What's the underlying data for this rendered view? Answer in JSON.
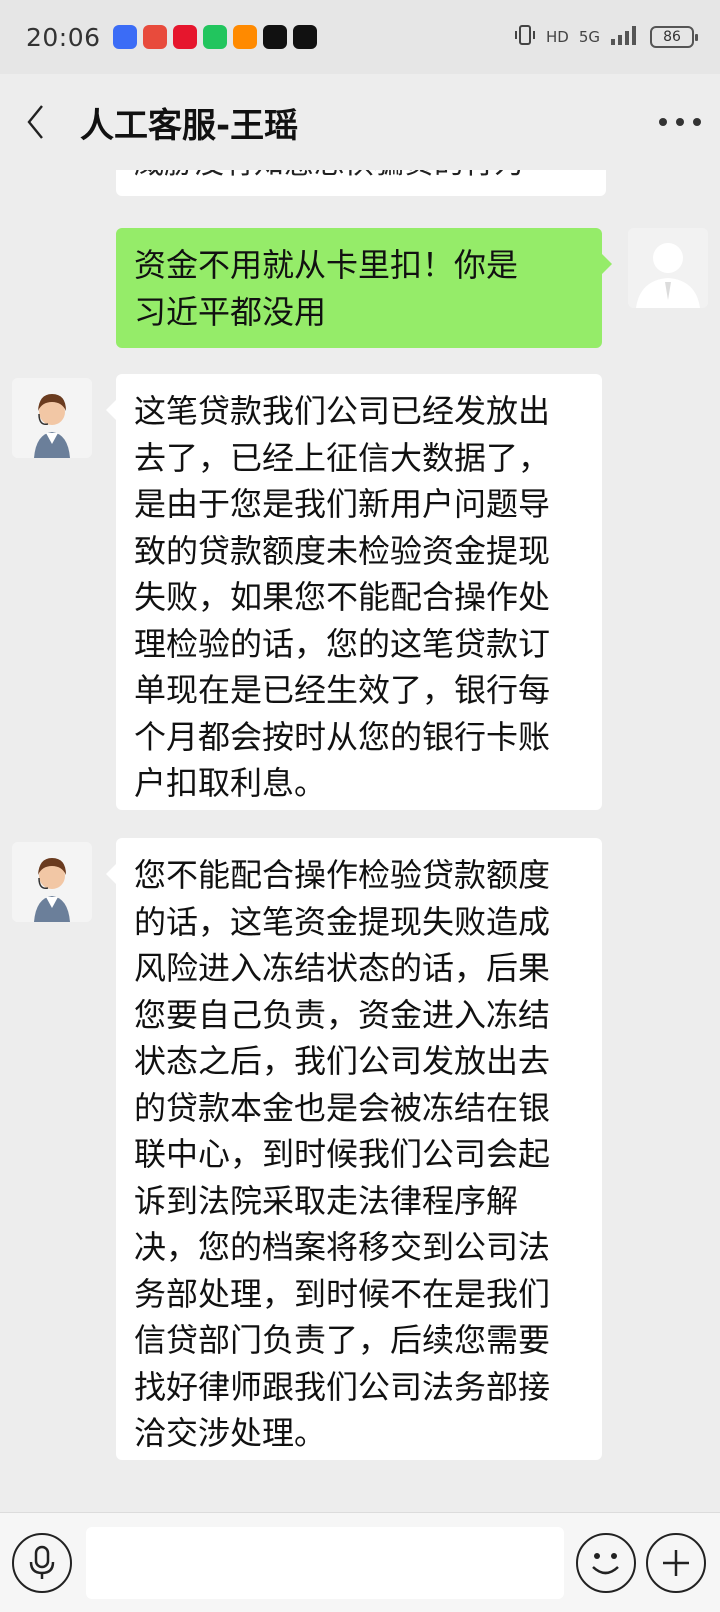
{
  "status_bar": {
    "time": "20:06",
    "network": "5G",
    "hd_label": "HD",
    "battery": "86",
    "notification_icons": [
      {
        "name": "baidu-icon",
        "color": "#3b6cf6"
      },
      {
        "name": "pinduoduo-icon",
        "color": "#e84b3c"
      },
      {
        "name": "weibo-icon",
        "color": "#e6162d"
      },
      {
        "name": "messages-icon",
        "color": "#22c55e"
      },
      {
        "name": "app-store-icon",
        "color": "#ff8a00"
      },
      {
        "name": "qq-icon",
        "color": "#111111"
      },
      {
        "name": "tiktok-icon",
        "color": "#111111"
      }
    ]
  },
  "header": {
    "title": "人工客服-王瑶"
  },
  "chat": {
    "partial_text": "威胁没有知感恐惧骗贷的行为",
    "messages": [
      {
        "sender": "me",
        "lines": [
          "资金不用就从卡里扣！你是",
          "习近平都没用"
        ]
      },
      {
        "sender": "agent",
        "lines": [
          "这笔贷款我们公司已经发放出",
          "去了，已经上征信大数据了，",
          "是由于您是我们新用户问题导",
          "致的贷款额度未检验资金提现",
          "失败，如果您不能配合操作处",
          "理检验的话，您的这笔贷款订",
          "单现在是已经生效了，银行每",
          "个月都会按时从您的银行卡账",
          "户扣取利息。"
        ]
      },
      {
        "sender": "agent",
        "lines": [
          "您不能配合操作检验贷款额度",
          "的话，这笔资金提现失败造成",
          "风险进入冻结状态的话，后果",
          "您要自己负责，资金进入冻结",
          "状态之后，我们公司发放出去",
          "的贷款本金也是会被冻结在银",
          "联中心，到时候我们公司会起",
          "诉到法院采取走法律程序解",
          "决，您的档案将移交到公司法",
          "务部处理，到时候不在是我们",
          "信贷部门负责了，后续您需要",
          "找好律师跟我们公司法务部接",
          "洽交涉处理。"
        ]
      }
    ]
  },
  "input_bar": {
    "value": "",
    "colors": {
      "me_bubble": "#95ec69",
      "agent_bubble": "#ffffff"
    }
  }
}
